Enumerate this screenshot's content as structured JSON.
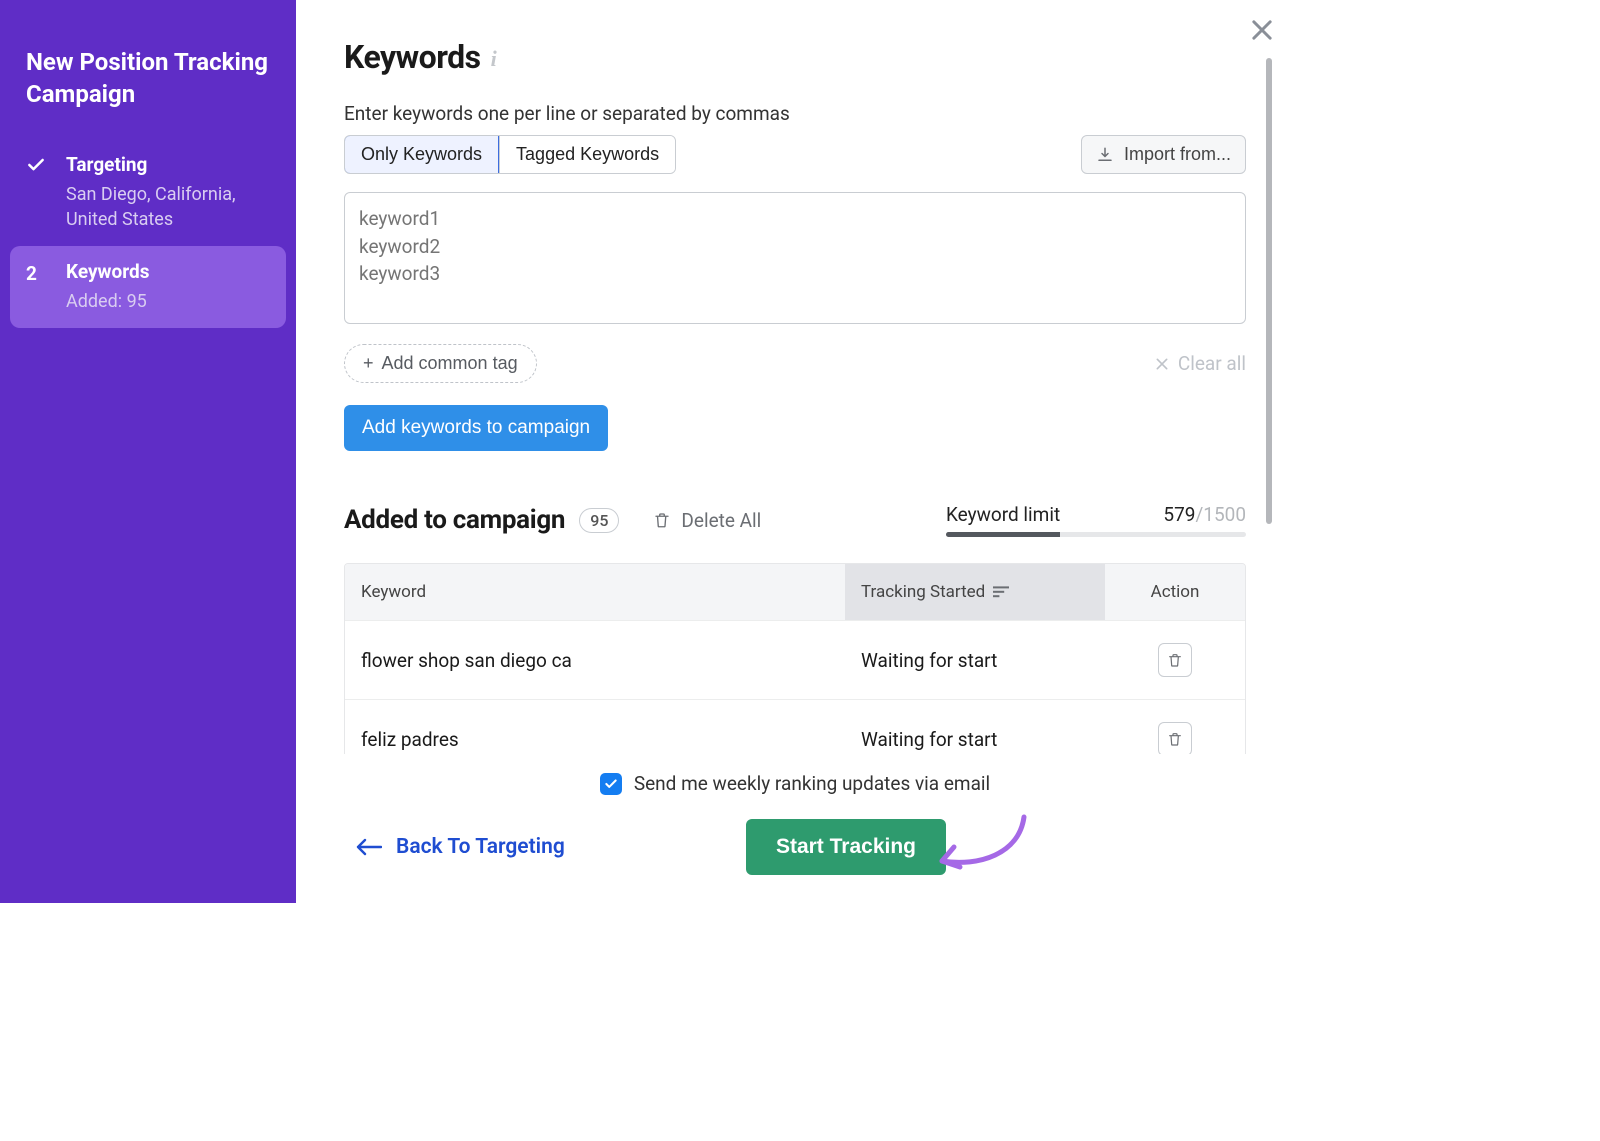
{
  "sidebar": {
    "title": "New Position Tracking Campaign",
    "steps": [
      {
        "marker_type": "check",
        "label": "Targeting",
        "sub": "San Diego, California, United States"
      },
      {
        "marker_type": "number",
        "marker": "2",
        "label": "Keywords",
        "sub": "Added: 95"
      }
    ]
  },
  "page": {
    "title": "Keywords",
    "hint": "Enter keywords one per line or separated by commas",
    "tabs": {
      "only": "Only Keywords",
      "tagged": "Tagged Keywords"
    },
    "import_label": "Import from...",
    "textarea_placeholder": "keyword1\nkeyword2\nkeyword3",
    "add_tag_label": "Add common tag",
    "clear_all_label": "Clear all",
    "add_keywords_label": "Add keywords to campaign"
  },
  "added": {
    "title": "Added to campaign",
    "count": "95",
    "delete_all_label": "Delete All",
    "limit_label": "Keyword limit",
    "limit_used": "579",
    "limit_total": "1500",
    "columns": {
      "keyword": "Keyword",
      "tracking": "Tracking Started",
      "action": "Action"
    },
    "rows": [
      {
        "keyword": "flower shop san diego ca",
        "status": "Waiting for start"
      },
      {
        "keyword": "feliz padres",
        "status": "Waiting for start"
      }
    ]
  },
  "footer": {
    "weekly_label": "Send me weekly ranking updates via email",
    "back_label": "Back To Targeting",
    "start_label": "Start Tracking"
  }
}
